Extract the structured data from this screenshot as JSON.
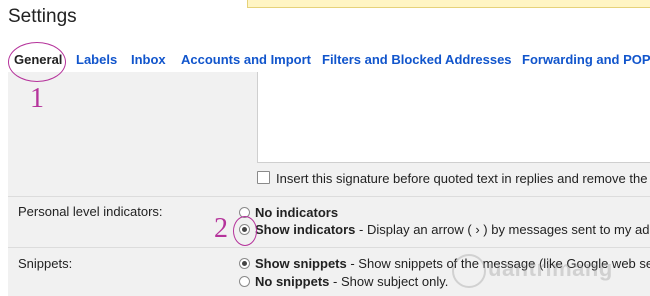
{
  "page": {
    "title": "Settings"
  },
  "tabs": [
    {
      "label": "General",
      "active": true
    },
    {
      "label": "Labels"
    },
    {
      "label": "Inbox"
    },
    {
      "label": "Accounts and Import"
    },
    {
      "label": "Filters and Blocked Addresses"
    },
    {
      "label": "Forwarding and POP/"
    }
  ],
  "annotations": {
    "one": "1",
    "two": "2"
  },
  "signature": {
    "checkbox_label": "Insert this signature before quoted text in replies and remove the \"--\" "
  },
  "personal_indicators": {
    "label": "Personal level indicators:",
    "options": [
      {
        "title": "No indicators",
        "desc": ""
      },
      {
        "title": "Show indicators",
        "desc": " - Display an arrow ( › ) by messages sent to my addre"
      }
    ],
    "selected": "Show indicators"
  },
  "snippets": {
    "label": "Snippets:",
    "options": [
      {
        "title": "Show snippets",
        "desc": " - Show snippets of the message (like Google web sear"
      },
      {
        "title": "No snippets",
        "desc": " - Show subject only."
      }
    ],
    "selected": "Show snippets"
  },
  "watermark": {
    "text": "uantrimang"
  },
  "colors": {
    "link": "#1155cc",
    "annotation": "#b5339b",
    "panel": "#f1f1f1"
  }
}
